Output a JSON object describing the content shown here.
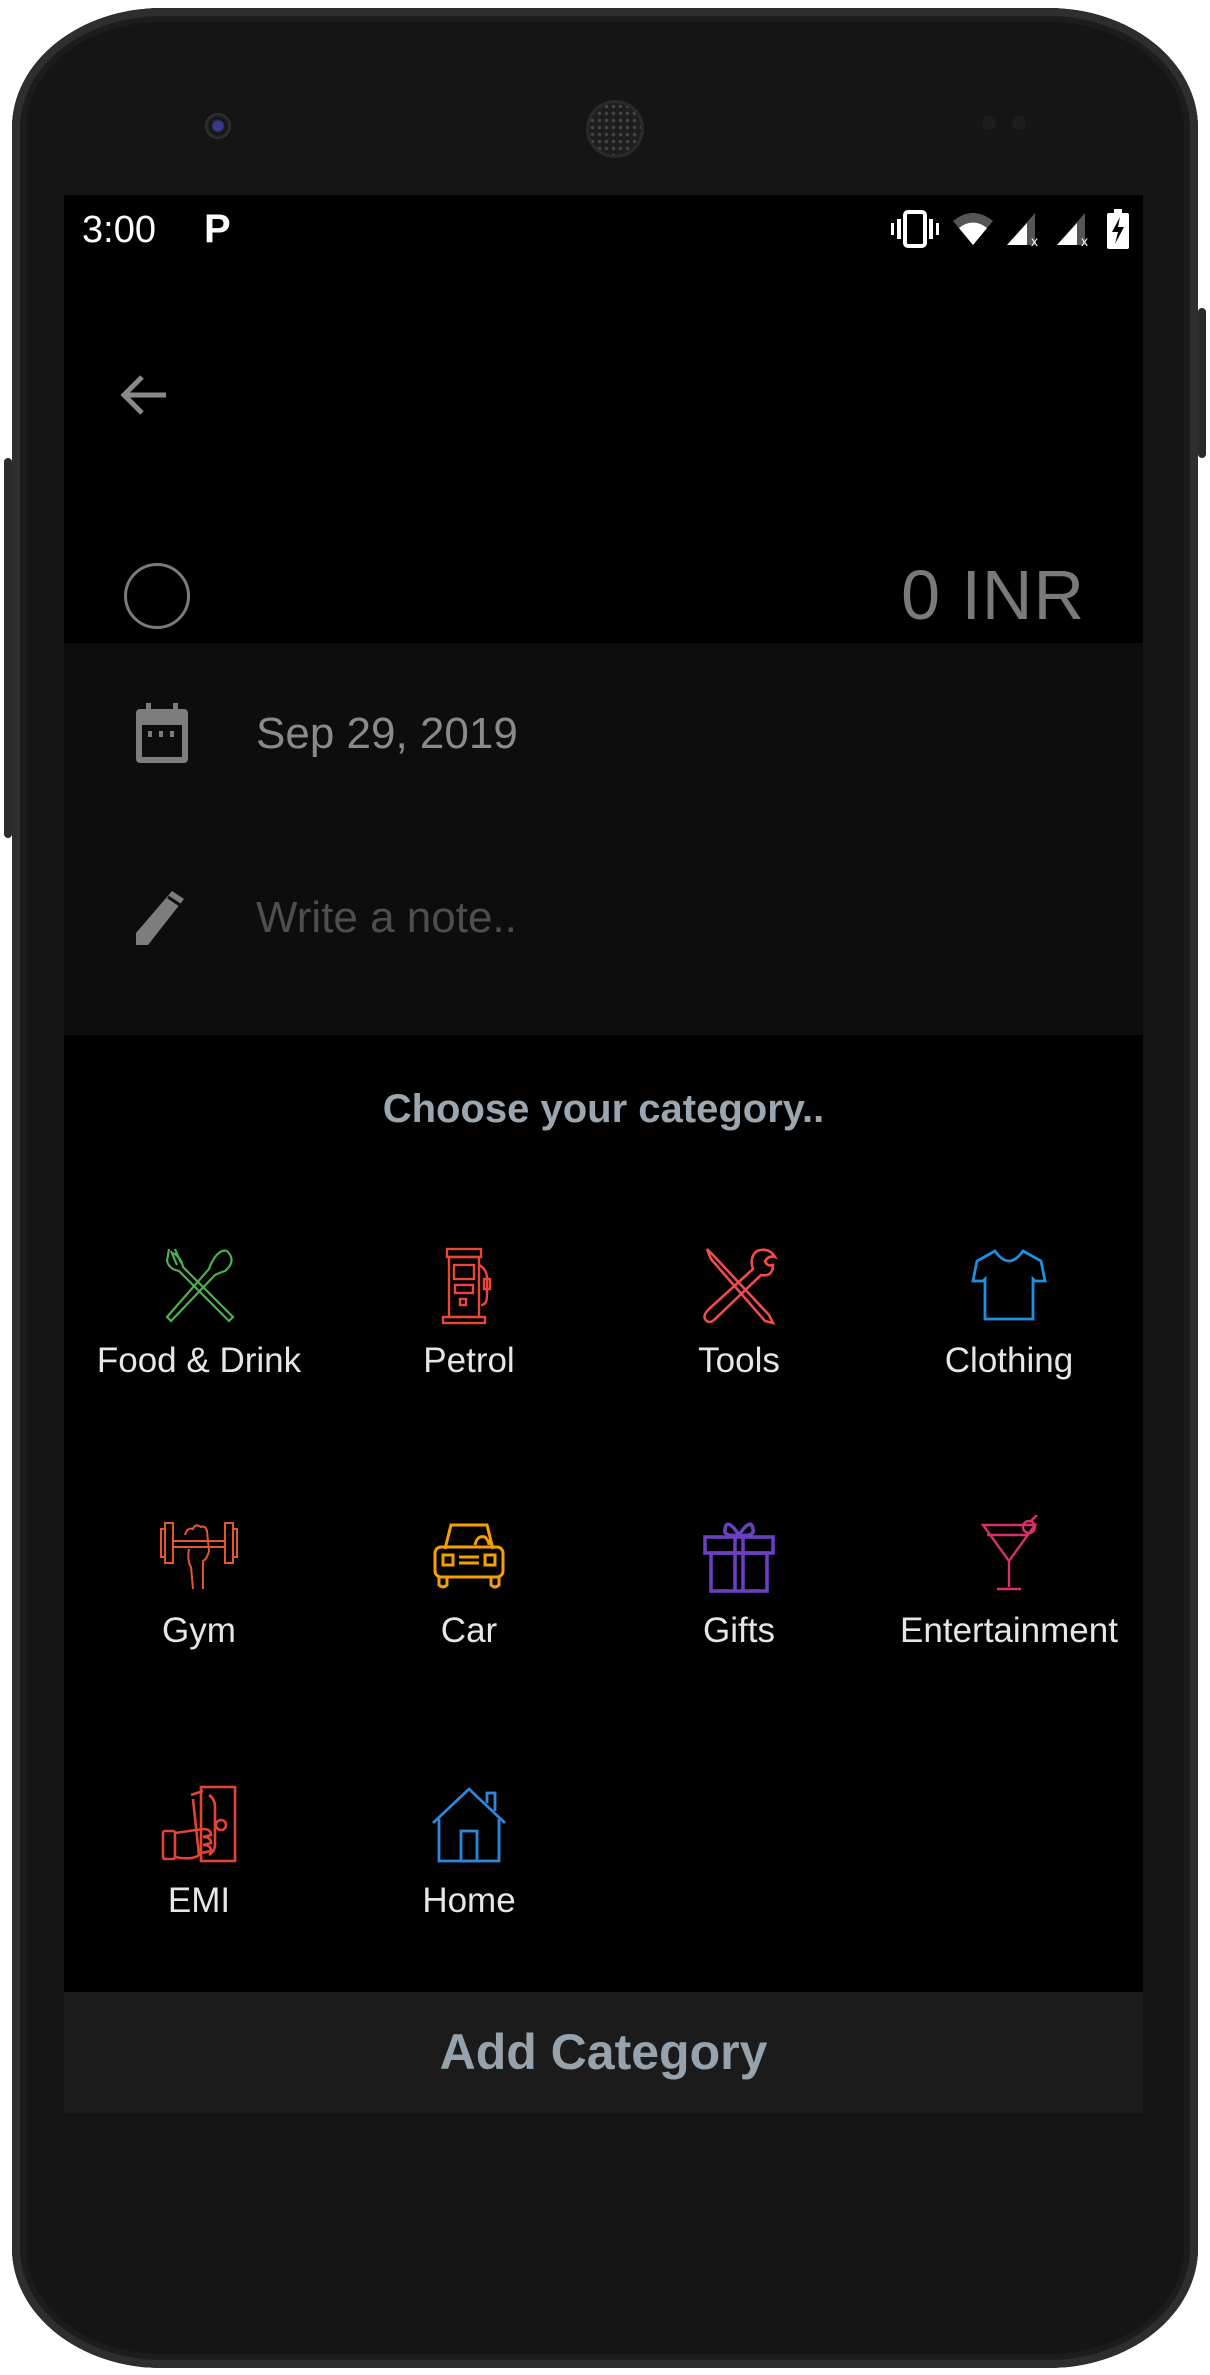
{
  "status_bar": {
    "time": "3:00",
    "notification_icon": "parking-p-icon",
    "icons": [
      "vibrate-icon",
      "wifi-icon",
      "signal-no-sim-icon",
      "signal-no-sim-icon",
      "battery-charging-icon"
    ]
  },
  "header": {
    "back_icon": "arrow-left-icon",
    "transaction_type_icon": "circle-outline-icon",
    "amount": "0 INR"
  },
  "form": {
    "date_icon": "calendar-icon",
    "date": "Sep 29, 2019",
    "note_icon": "pencil-icon",
    "note_value": "",
    "note_placeholder": "Write a note.."
  },
  "categories": {
    "title": "Choose your category..",
    "items": [
      {
        "label": "Food & Drink",
        "icon": "fork-spoon-icon",
        "color": "#4caf50"
      },
      {
        "label": "Petrol",
        "icon": "fuel-pump-icon",
        "color": "#e8473b"
      },
      {
        "label": "Tools",
        "icon": "wrench-screwdriver-icon",
        "color": "#f04b4b"
      },
      {
        "label": "Clothing",
        "icon": "tshirt-icon",
        "color": "#1e90e0"
      },
      {
        "label": "Gym",
        "icon": "dumbbell-icon",
        "color": "#e2572d"
      },
      {
        "label": "Car",
        "icon": "car-icon",
        "color": "#f5a000"
      },
      {
        "label": "Gifts",
        "icon": "gift-icon",
        "color": "#6a3fc0"
      },
      {
        "label": "Entertainment",
        "icon": "cocktail-icon",
        "color": "#d6326a"
      },
      {
        "label": "EMI",
        "icon": "cash-hand-icon",
        "color": "#e44336"
      },
      {
        "label": "Home",
        "icon": "house-icon",
        "color": "#2f86d8"
      }
    ]
  },
  "footer": {
    "add_category_label": "Add Category"
  }
}
